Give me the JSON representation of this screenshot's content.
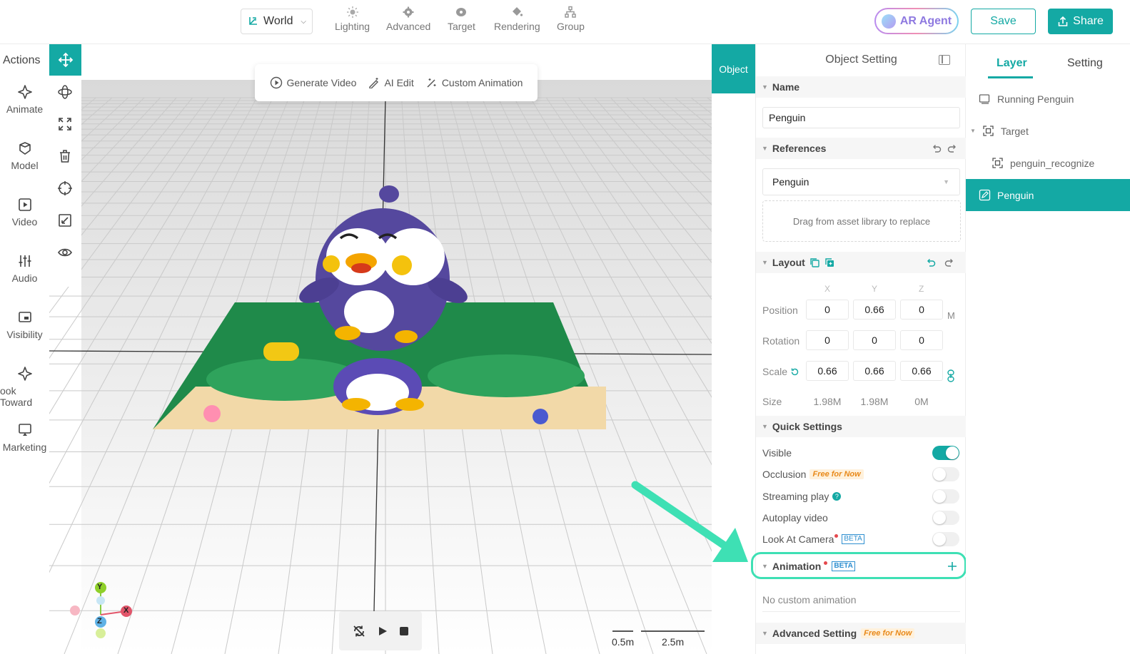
{
  "topbar": {
    "world": "World",
    "tools": [
      "Lighting",
      "Advanced",
      "Target",
      "Rendering",
      "Group"
    ],
    "ar_agent": "AR Agent",
    "save": "Save",
    "share": "Share"
  },
  "actions": {
    "title": "Actions",
    "items": [
      "Animate",
      "Model",
      "Video",
      "Audio",
      "Visibility",
      "ook Toward",
      "Marketing"
    ]
  },
  "viewport": {
    "gen_bar": {
      "generate_video": "Generate Video",
      "ai_edit": "AI Edit",
      "custom_animation": "Custom Animation"
    },
    "scale_labels": [
      "0.5m",
      "2.5m"
    ],
    "gizmo": {
      "y": "Y",
      "x": "X",
      "z": "Z"
    }
  },
  "object_tab": "Object",
  "panel": {
    "title": "Object Setting",
    "name_label": "Name",
    "name_value": "Penguin",
    "references_label": "References",
    "reference_value": "Penguin",
    "dropzone": "Drag from asset library to replace",
    "layout_label": "Layout",
    "axes": [
      "X",
      "Y",
      "Z"
    ],
    "position_label": "Position",
    "position": [
      "0",
      "0.66",
      "0"
    ],
    "unit": "M",
    "rotation_label": "Rotation",
    "rotation": [
      "0",
      "0",
      "0"
    ],
    "scale_label": "Scale",
    "scale": [
      "0.66",
      "0.66",
      "0.66"
    ],
    "size_label": "Size",
    "size": [
      "1.98M",
      "1.98M",
      "0M"
    ],
    "quick_settings_label": "Quick Settings",
    "quick_settings": [
      {
        "label": "Visible",
        "on": true
      },
      {
        "label": "Occlusion",
        "badge": "Free for Now",
        "on": false
      },
      {
        "label": "Streaming play",
        "help": "?",
        "on": false
      },
      {
        "label": "Autoplay video",
        "on": false
      },
      {
        "label": "Look At Camera",
        "beta": "BETA",
        "on": false
      }
    ],
    "animation_label": "Animation",
    "animation_beta": "BETA",
    "no_animation": "No custom animation",
    "advanced_label": "Advanced Setting",
    "advanced_badge": "Free for Now"
  },
  "layers": {
    "tabs": [
      "Layer",
      "Setting"
    ],
    "items": [
      "Running Penguin",
      "Target",
      "penguin_recognize",
      "Penguin"
    ]
  },
  "colors": {
    "accent": "#14a9a4",
    "highlight": "#3ee0b4"
  }
}
